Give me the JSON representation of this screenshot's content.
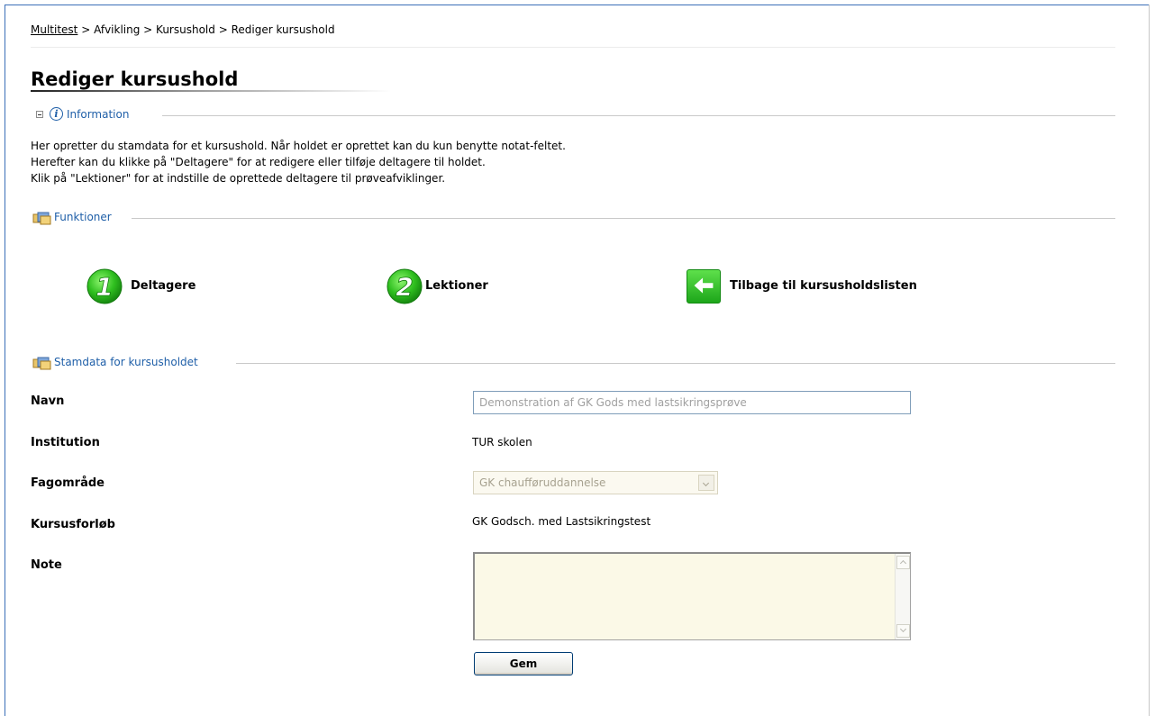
{
  "breadcrumb": {
    "root": "Multitest",
    "sep1": " > ",
    "step1": "Afvikling",
    "sep2": " > ",
    "step2": "Kursushold",
    "sep3": " > ",
    "current": "Rediger kursushold"
  },
  "page_title": "Rediger kursushold",
  "sections": {
    "information": "Information",
    "funktioner": "Funktioner",
    "stamdata": "Stamdata for kursusholdet"
  },
  "info_lines": [
    "Her opretter du stamdata for et kursushold. Når holdet er oprettet kan du kun benytte notat-feltet.",
    "Herefter kan du klikke på \"Deltagere\" for at redigere eller tilføje deltagere til holdet.",
    "Klik på \"Lektioner\" for at indstille de oprettede deltagere til prøveafviklinger."
  ],
  "functions": {
    "deltagere": {
      "number": "1",
      "label": "Deltagere"
    },
    "lektioner": {
      "number": "2",
      "label": "Lektioner"
    },
    "back": {
      "label": "Tilbage til kursusholdslisten"
    }
  },
  "form": {
    "navn_label": "Navn",
    "navn_value": "Demonstration af GK Gods med lastsikringsprøve",
    "institution_label": "Institution",
    "institution_value": "TUR skolen",
    "fagomraade_label": "Fagområde",
    "fagomraade_value": "GK chaufføruddannelse",
    "kursusforloeb_label": "Kursusforløb",
    "kursusforloeb_value": "GK Godsch. med Lastsikringstest",
    "note_label": "Note",
    "note_value": ""
  },
  "save_button": "Gem",
  "colors": {
    "section_heading": "#1f5fa8",
    "number_badge": "#2fbf1f",
    "frame_border": "#3b6fb8"
  },
  "icons": {
    "info": "info-icon",
    "collapse": "collapse-icon",
    "folder": "folder-icon",
    "back_arrow": "arrow-left-icon"
  }
}
